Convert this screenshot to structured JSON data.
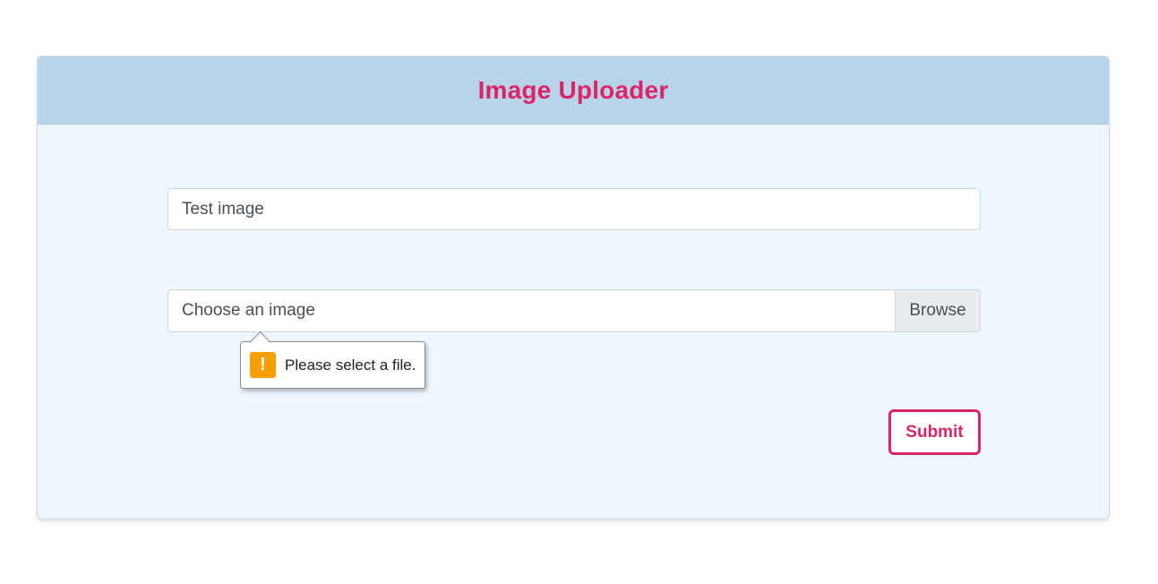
{
  "header": {
    "title": "Image Uploader"
  },
  "form": {
    "title_input_value": "Test image",
    "file_label": "Choose an image",
    "browse_label": "Browse",
    "submit_label": "Submit"
  },
  "validation_tooltip": {
    "icon": "warning-icon",
    "icon_glyph": "!",
    "message": "Please select a file."
  },
  "colors": {
    "accent": "#dc2566",
    "header_bg": "#b7d4eb",
    "card_bg": "#eef6fe",
    "warning": "#f5a000"
  }
}
